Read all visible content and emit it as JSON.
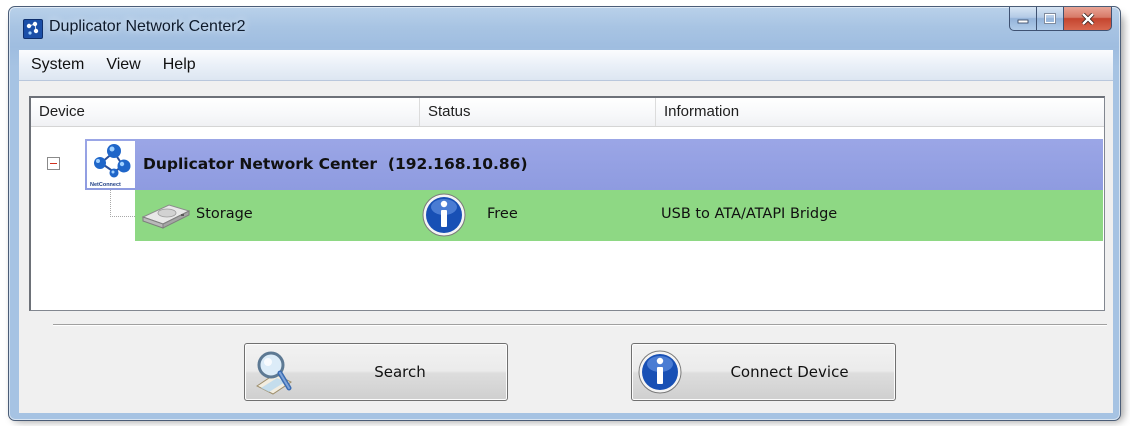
{
  "window": {
    "title": "Duplicator Network Center2",
    "controls": {
      "minimize": "minimize",
      "maximize": "maximize",
      "close": "close"
    }
  },
  "menu": {
    "items": [
      {
        "label": "System"
      },
      {
        "label": "View"
      },
      {
        "label": "Help"
      }
    ]
  },
  "device_list": {
    "columns": [
      "Device",
      "Status",
      "Information"
    ],
    "group": {
      "name": "Duplicator Network Center  (192.168.10.86)",
      "icon": "netconnect-icon",
      "icon_caption": "NetConnect",
      "expanded": true,
      "row_color": "#9ba6e6"
    },
    "rows": [
      {
        "device": "Storage",
        "status": "Free",
        "information": "USB to ATA/ATAPI Bridge",
        "icon": "storage-icon",
        "status_icon": "info-icon",
        "row_color": "#8ed884"
      }
    ]
  },
  "buttons": {
    "search": {
      "label": "Search",
      "icon": "search-icon"
    },
    "connect": {
      "label": "Connect Device",
      "icon": "info-icon"
    }
  }
}
